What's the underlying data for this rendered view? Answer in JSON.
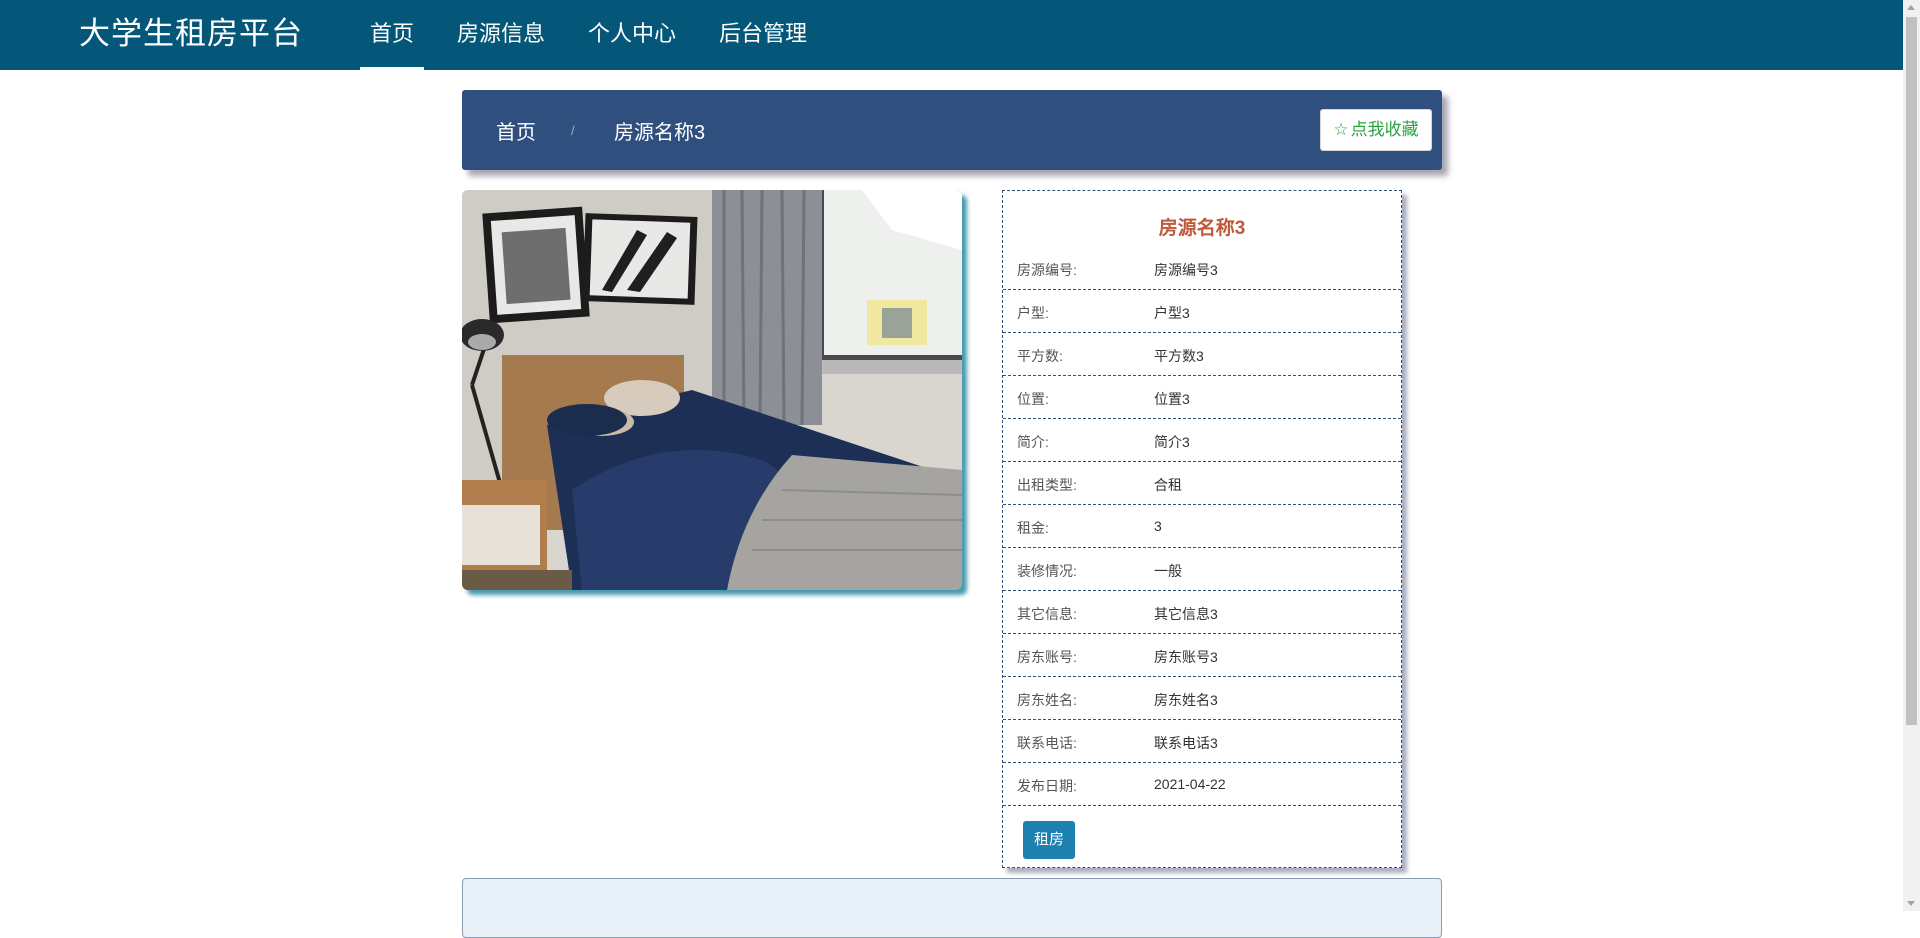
{
  "header": {
    "brand": "大学生租房平台",
    "nav": [
      "首页",
      "房源信息",
      "个人中心",
      "后台管理"
    ],
    "active_index": 0
  },
  "breadcrumb": {
    "home": "首页",
    "separator": "/",
    "current": "房源名称3"
  },
  "favorite_button": {
    "icon": "star-outline-icon",
    "label": "点我收藏"
  },
  "photo": {
    "alt": "bedroom-photo"
  },
  "detail": {
    "title": "房源名称3",
    "fields": [
      {
        "label": "房源编号:",
        "value": "房源编号3"
      },
      {
        "label": "户型:",
        "value": "户型3"
      },
      {
        "label": "平方数:",
        "value": "平方数3"
      },
      {
        "label": "位置:",
        "value": "位置3"
      },
      {
        "label": "简介:",
        "value": "简介3"
      },
      {
        "label": "出租类型:",
        "value": "合租"
      },
      {
        "label": "租金:",
        "value": "3"
      },
      {
        "label": "装修情况:",
        "value": "一般"
      },
      {
        "label": "其它信息:",
        "value": "其它信息3"
      },
      {
        "label": "房东账号:",
        "value": "房东账号3"
      },
      {
        "label": "房东姓名:",
        "value": "房东姓名3"
      },
      {
        "label": "联系电话:",
        "value": "联系电话3"
      },
      {
        "label": "发布日期:",
        "value": "2021-04-22"
      }
    ],
    "rent_button": "租房"
  },
  "colors": {
    "header_bg": "#045779",
    "breadcrumb_bg": "#2f4f7f",
    "title_color": "#c0583a",
    "favorite_color": "#2aa53f",
    "rent_button_bg": "#1e7fb1"
  }
}
